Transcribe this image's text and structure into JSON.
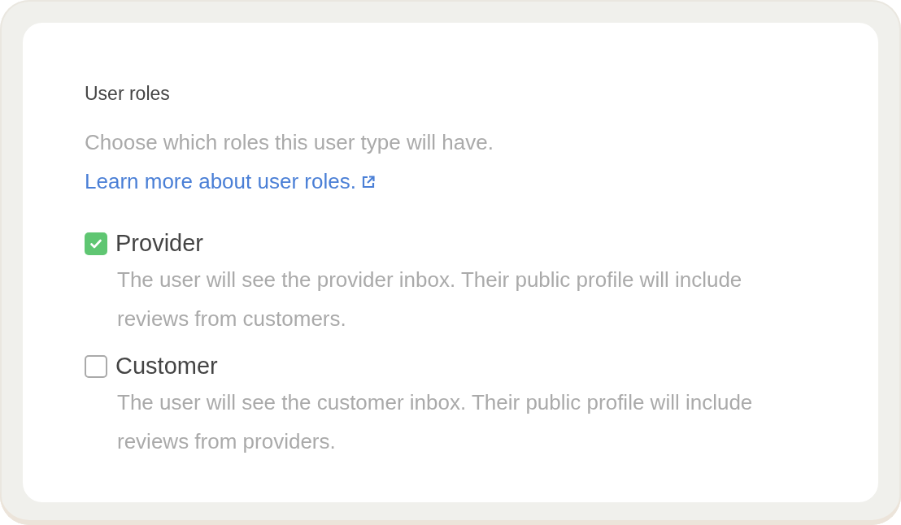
{
  "section": {
    "title": "User roles",
    "description": "Choose which roles this user type will have.",
    "link": "Learn more about user roles."
  },
  "options": [
    {
      "label": "Provider",
      "checked": true,
      "description": "The user will see the provider inbox. Their public profile will include reviews from customers."
    },
    {
      "label": "Customer",
      "checked": false,
      "description": "The user will see the customer inbox. Their public profile will include reviews from providers."
    }
  ]
}
